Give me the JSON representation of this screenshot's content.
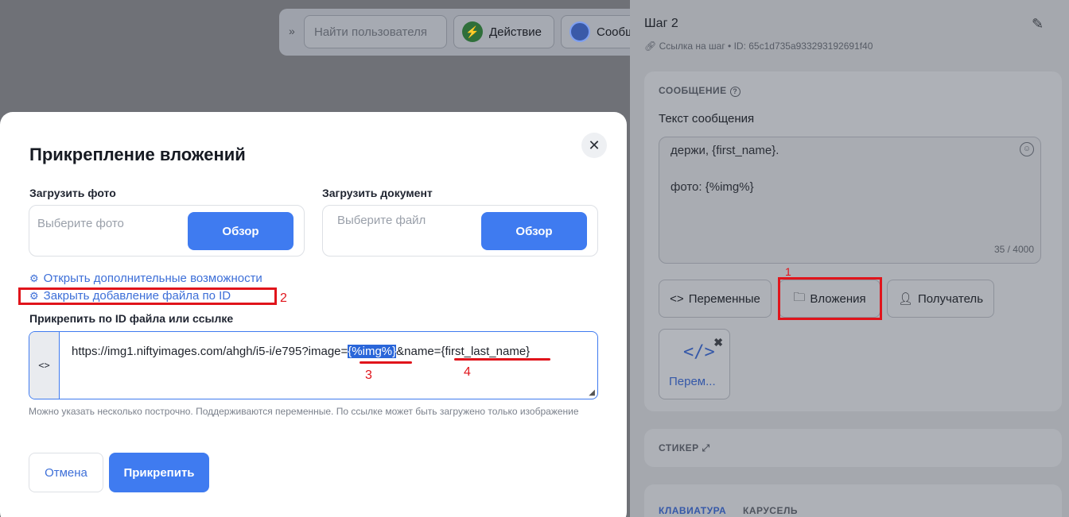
{
  "toolbar": {
    "search_placeholder": "Найти пользователя",
    "action_label": "Действие",
    "message_label": "Сообщ",
    "action_icon": "lightning-icon",
    "message_icon": "chat-bubble-icon"
  },
  "step": {
    "title": "Шаг 2",
    "meta": "Ссылка на шаг • ID: 65c1d735a933293192691f40"
  },
  "message_section": {
    "label": "СООБЩЕНИЕ",
    "text_label": "Текст сообщения",
    "line1": "держи, {first_name}.",
    "line2": "фото: {%img%}",
    "counter": "35 / 4000",
    "buttons": {
      "variables": "Переменные",
      "attachments": "Вложения",
      "recipient": "Получатель"
    },
    "var_card_label": "Перем..."
  },
  "sticker_section": {
    "label": "СТИКЕР"
  },
  "keyboard_section": {
    "tab_keyboard": "КЛАВИАТУРА",
    "tab_carousel": "КАРУСЕЛЬ"
  },
  "modal": {
    "title": "Прикрепление вложений",
    "photo_label": "Загрузить фото",
    "photo_placeholder": "Выберите фото",
    "doc_label": "Загрузить документ",
    "doc_placeholder": "Выберите файл",
    "browse": "Обзор",
    "link_more": "Открыть дополнительные возможности",
    "link_close_id": "Закрыть добавление файла по ID",
    "id_label": "Прикрепить по ID файла или ссылке",
    "url_prefix": "<>",
    "url_part1": "https://img1.niftyimages.com/ahgh/i5-i/e795?image=",
    "url_highlight": "{%img%}",
    "url_part2": "&name=",
    "url_part3": "{first_last_name}",
    "hint": "Можно указать несколько построчно. Поддерживаются переменные. По ссылке может быть загружено только изображение",
    "cancel": "Отмена",
    "attach": "Прикрепить"
  },
  "annotations": {
    "n1": "1",
    "n2": "2",
    "n3": "3",
    "n4": "4",
    "color": "#e0141b"
  },
  "colors": {
    "accent": "#3f7bf0",
    "link": "#3d6fd8",
    "overlay": "#6f7177"
  }
}
